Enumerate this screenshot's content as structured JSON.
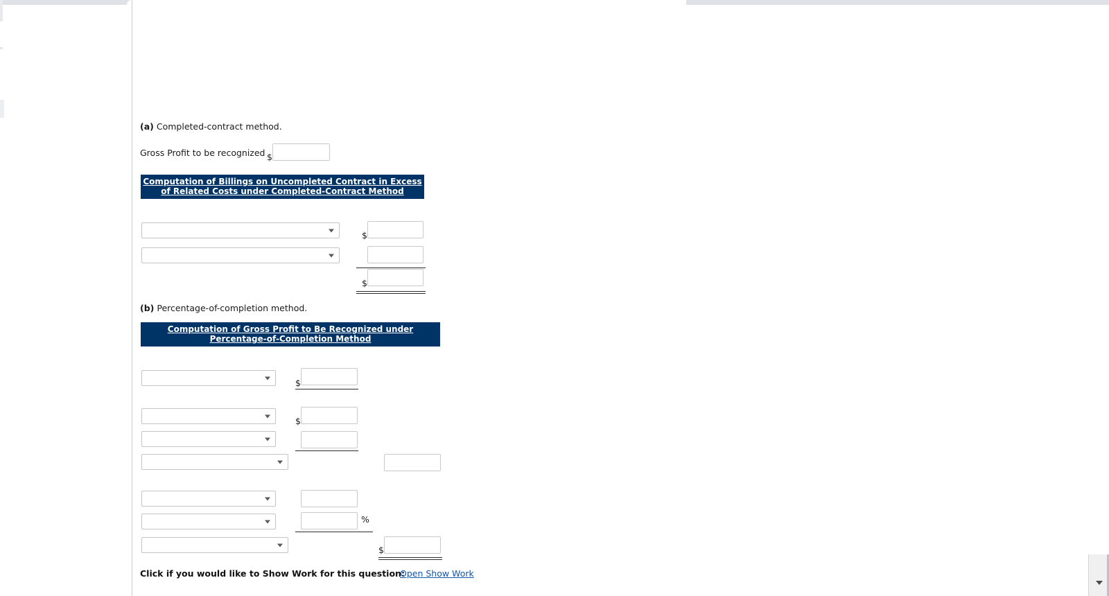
{
  "page": {
    "part_a": {
      "marker": "(a)",
      "text": "Completed-contract method."
    },
    "gross_profit_row": {
      "label": "Gross Profit to be recognized",
      "currency": "$",
      "value": "",
      "placeholder": ""
    },
    "banner_a": "Computation of Billings on Uncompleted Contract in Excess of Related Costs under Completed-Contract Method",
    "table_a": {
      "rows": [
        {
          "select_value": "",
          "currency": "$",
          "amount": ""
        },
        {
          "select_value": "",
          "currency": "",
          "amount": ""
        },
        {
          "select_value": "",
          "currency": "$",
          "amount": ""
        }
      ]
    },
    "part_b": {
      "marker": "(b)",
      "text": "Percentage-of-completion method."
    },
    "banner_b": "Computation of Gross Profit to Be Recognized under Percentage-of-Completion Method",
    "table_b": {
      "rows": [
        {
          "select_value": "",
          "currency": "$",
          "amount": "",
          "suffix": ""
        },
        {
          "select_value": "",
          "currency": "$",
          "amount": "",
          "suffix": ""
        },
        {
          "select_value": "",
          "currency": "",
          "amount": "",
          "suffix": ""
        },
        {
          "select_value": "",
          "currency": "",
          "amount": "",
          "suffix": ""
        },
        {
          "select_value": "",
          "currency": "",
          "amount": "",
          "suffix": ""
        },
        {
          "select_value": "",
          "currency": "",
          "amount": "",
          "suffix": "%"
        },
        {
          "select_value": "",
          "currency": "$",
          "amount": "",
          "suffix": ""
        }
      ]
    },
    "footer": {
      "label": "Click if you would like to Show Work for this question:",
      "link": "Open Show Work"
    },
    "colors": {
      "banner_bg": "#003366",
      "banner_text": "#ffffff",
      "link": "#1155aa",
      "rule": "#2b2b2b"
    }
  }
}
